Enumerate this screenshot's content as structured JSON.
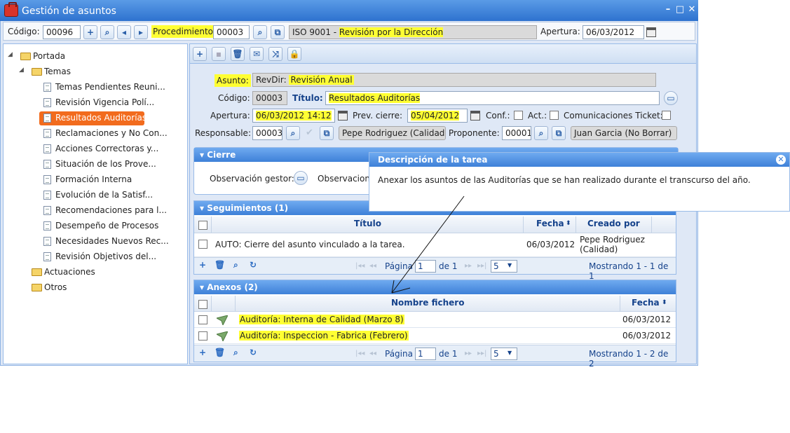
{
  "window": {
    "title": "Gestión de asuntos"
  },
  "header": {
    "codigo_label": "Código:",
    "codigo_value": "00096",
    "procedimiento_label": "Procedimiento",
    "procedimiento_value": "00003",
    "proc_name_prefix": "ISO 9001 - ",
    "proc_name": "Revisión por la Dirección",
    "apertura_label": "Apertura:",
    "apertura_value": "06/03/2012"
  },
  "tree": {
    "root": "Portada",
    "temas": "Temas",
    "items": [
      "Temas Pendientes Reuni...",
      "Revisión Vigencia Polí...",
      "Resultados Auditorías",
      "Reclamaciones y No Con...",
      "Acciones Correctoras y...",
      "Situación de los Prove...",
      "Formación Interna",
      "Evolución de la Satisf...",
      "Recomendaciones para l...",
      "Desempeño de Procesos",
      "Necesidades Nuevos Rec...",
      "Revisión Objetivos del..."
    ],
    "actuaciones": "Actuaciones",
    "otros": "Otros"
  },
  "form": {
    "asunto_label": "Asunto:",
    "asunto_prefix": "RevDir:",
    "asunto_value": "Revisión Anual",
    "codigo_label": "Código:",
    "codigo_value": "00003",
    "titulo_label": "Título:",
    "titulo_value": "Resultados Auditorías",
    "apertura_label": "Apertura:",
    "apertura_value": "06/03/2012 14:12",
    "prevcierre_label": "Prev. cierre:",
    "prevcierre_value": "05/04/2012",
    "conf_label": "Conf.:",
    "act_label": "Act.:",
    "comunic_label": "Comunicaciones Ticket:",
    "responsable_label": "Responsable:",
    "responsable_code": "00003",
    "responsable_name": "Pepe Rodriguez (Calidad)",
    "proponente_label": "Proponente:",
    "proponente_code": "00001",
    "proponente_name": "Juan Garcia  (No Borrar)"
  },
  "cierre": {
    "title": "Cierre",
    "obs_gestor": "Observación gestor:",
    "obs_other": "Observacion"
  },
  "seguimientos": {
    "title": "Seguimientos (1)",
    "columns": [
      "Título",
      "Fecha",
      "Creado por"
    ],
    "rows": [
      {
        "titulo": "AUTO: Cierre del asunto vinculado a la tarea.",
        "fecha": "06/03/2012",
        "creado1": "Pepe Rodriguez",
        "creado2": "(Calidad)"
      }
    ],
    "pager": {
      "pagina": "Página",
      "page": "1",
      "of": "de 1",
      "size": "5",
      "status": "Mostrando 1 - 1 de 1"
    }
  },
  "anexos": {
    "title": "Anexos (2)",
    "columns": [
      "Nombre fichero",
      "Fecha"
    ],
    "rows": [
      {
        "name": "Auditoría: Interna de Calidad (Marzo 8)",
        "fecha": "06/03/2012"
      },
      {
        "name": "Auditoría: Inspeccion - Fabrica (Febrero)",
        "fecha": "06/03/2012"
      }
    ],
    "pager": {
      "pagina": "Página",
      "page": "1",
      "of": "de 1",
      "size": "5",
      "status": "Mostrando 1 - 2 de 2"
    }
  },
  "popup": {
    "title": "Descripción de la tarea",
    "text": "Anexar los asuntos de las Auditorías que se han realizado durante el transcurso del año."
  },
  "colors": {
    "highlight": "#ffff33",
    "selected": "#f26b1d",
    "header": "#3e81d8"
  }
}
